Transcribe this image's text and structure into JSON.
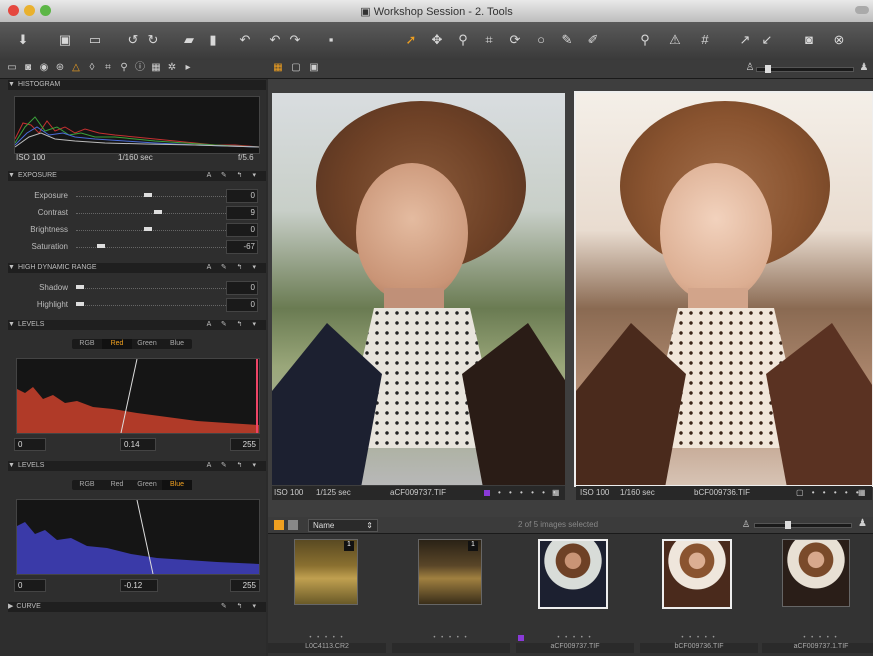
{
  "window": {
    "title": "Workshop Session - 2. Tools"
  },
  "histogram": {
    "section": "HISTOGRAM",
    "iso": "ISO 100",
    "shutter": "1/160 sec",
    "aperture": "f/5.6"
  },
  "exposure": {
    "section": "EXPOSURE",
    "sliders": [
      {
        "label": "Exposure",
        "value": "0",
        "pos": 0.45
      },
      {
        "label": "Contrast",
        "value": "9",
        "pos": 0.52
      },
      {
        "label": "Brightness",
        "value": "0",
        "pos": 0.45
      },
      {
        "label": "Saturation",
        "value": "-67",
        "pos": 0.14
      }
    ]
  },
  "hdr": {
    "section": "HIGH DYNAMIC RANGE",
    "sliders": [
      {
        "label": "Shadow",
        "value": "0",
        "pos": 0.0
      },
      {
        "label": "Highlight",
        "value": "0",
        "pos": 0.0
      }
    ]
  },
  "levels1": {
    "section": "LEVELS",
    "tabs": [
      "RGB",
      "Red",
      "Green",
      "Blue"
    ],
    "selected": "Red",
    "low": "0",
    "mid": "0.14",
    "high": "255",
    "color": "#b03a28"
  },
  "levels2": {
    "section": "LEVELS",
    "tabs": [
      "RGB",
      "Red",
      "Green",
      "Blue"
    ],
    "selected": "Blue",
    "low": "0",
    "mid": "-0.12",
    "high": "255",
    "color": "#3a3aa8"
  },
  "curve": {
    "section": "CURVE"
  },
  "viewer": {
    "left": {
      "iso": "ISO 100",
      "shutter": "1/125 sec",
      "file": "aCF009737.TIF"
    },
    "right": {
      "iso": "ISO 100",
      "shutter": "1/160 sec",
      "file": "bCF009736.TIF"
    }
  },
  "browser": {
    "sort": "Name",
    "status": "2 of 5 images selected",
    "thumbs": [
      {
        "name": "L0C4113.CR2",
        "rating": "• • • • •"
      },
      {
        "name": "",
        "rating": "• • • • •"
      },
      {
        "name": "aCF009737.TIF",
        "rating": "• • • • •"
      },
      {
        "name": "bCF009736.TIF",
        "rating": "• • • • •"
      },
      {
        "name": "aCF009737.1.TIF",
        "rating": "• • • • •"
      }
    ]
  },
  "colors": {
    "accent": "#f0a020",
    "panel": "#2e2e2e",
    "viewer": "#3e3e3e"
  }
}
